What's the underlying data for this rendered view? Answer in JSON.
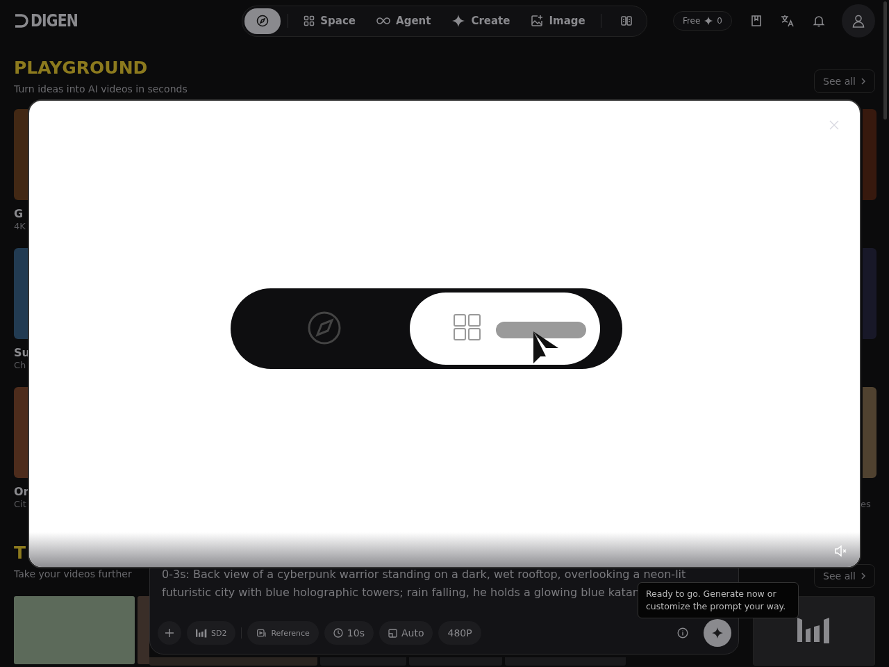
{
  "header": {
    "logo": "DIGEN",
    "nav_tabs": [
      {
        "kind": "icon",
        "selected": true
      },
      {
        "kind": "text",
        "label": "Space",
        "selected": false
      },
      {
        "kind": "text",
        "label": "Agent",
        "selected": false
      },
      {
        "kind": "text",
        "label": "Create",
        "selected": false
      },
      {
        "kind": "text",
        "label": "Image",
        "selected": false
      },
      {
        "kind": "icon",
        "selected": false
      }
    ],
    "credits": {
      "label": "Free",
      "count": "0"
    }
  },
  "playground": {
    "title": "PLAYGROUND",
    "subtitle": "Turn ideas into AI videos in seconds",
    "see_all": "See all",
    "left_cards": [
      {
        "title": "G",
        "subtitle": "4K"
      },
      {
        "title": "Su",
        "subtitle": "Ch"
      },
      {
        "title": "Or",
        "subtitle": "Cit"
      }
    ],
    "right_caption": "es"
  },
  "tools": {
    "title": "T",
    "subtitle": "Take your videos further",
    "see_all": "See all"
  },
  "video_modal": {
    "muted": true
  },
  "composer": {
    "prompt": "0-3s: Back view of a cyberpunk warrior standing on a dark, wet rooftop, overlooking a neon-lit futuristic city with blue holographic towers; rain falling, he holds a glowing blue katan",
    "options": [
      {
        "kind": "add"
      },
      {
        "kind": "model",
        "label": "SD2"
      },
      {
        "kind": "reference",
        "label": "Reference"
      },
      {
        "kind": "duration",
        "label": "10s"
      },
      {
        "kind": "ratio",
        "label": "Auto"
      },
      {
        "kind": "resolution",
        "label": "480P"
      }
    ]
  },
  "tooltip": "Ready to go. Generate now or customize the prompt your way."
}
